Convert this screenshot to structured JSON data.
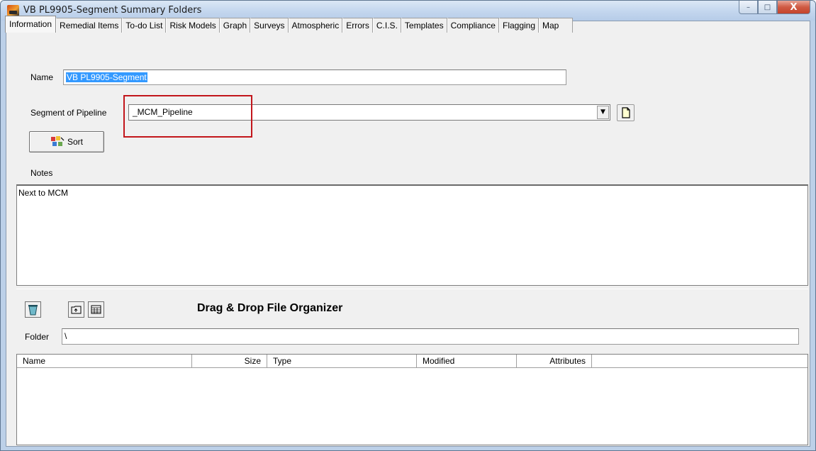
{
  "window": {
    "title": "VB PL9905-Segment Summary Folders",
    "minimize_glyph": "–",
    "maximize_glyph": "□",
    "close_glyph": "X"
  },
  "tabs": [
    {
      "label": "Information",
      "active": true
    },
    {
      "label": "Remedial Items"
    },
    {
      "label": "To-do List"
    },
    {
      "label": "Risk Models"
    },
    {
      "label": "Graph"
    },
    {
      "label": "Surveys"
    },
    {
      "label": "Atmospheric"
    },
    {
      "label": "Errors"
    },
    {
      "label": "C.I.S."
    },
    {
      "label": "Templates"
    },
    {
      "label": "Compliance"
    },
    {
      "label": "Flagging"
    },
    {
      "label": "Map"
    }
  ],
  "info": {
    "name_label": "Name",
    "name_value": "VB PL9905-Segment",
    "segment_label": "Segment of Pipeline",
    "segment_value": "_MCM_Pipeline",
    "sort_label": "Sort",
    "notes_label": "Notes",
    "notes_value": "Next to MCM"
  },
  "organizer": {
    "title": "Drag & Drop File Organizer",
    "folder_label": "Folder",
    "folder_value": "\\",
    "columns": [
      "Name",
      "Size",
      "Type",
      "Modified",
      "Attributes"
    ]
  },
  "colors": {
    "highlight_box": "#c2161c",
    "selection": "#3399ff"
  }
}
